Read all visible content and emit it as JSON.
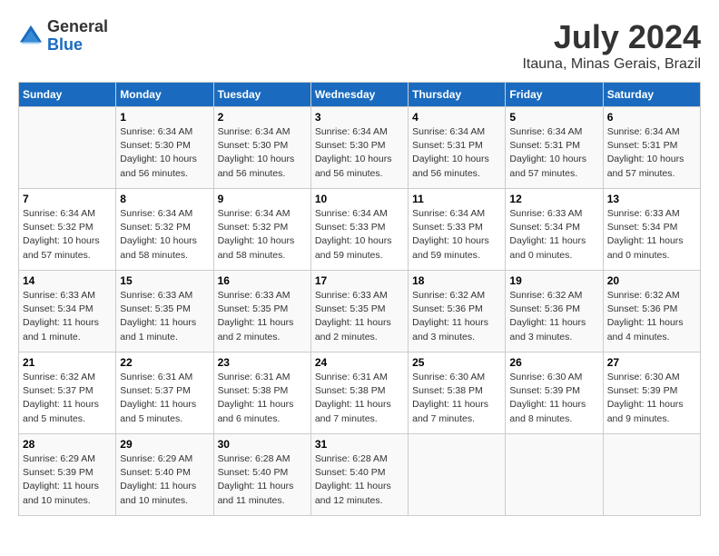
{
  "header": {
    "logo_general": "General",
    "logo_blue": "Blue",
    "month_title": "July 2024",
    "location": "Itauna, Minas Gerais, Brazil"
  },
  "days_of_week": [
    "Sunday",
    "Monday",
    "Tuesday",
    "Wednesday",
    "Thursday",
    "Friday",
    "Saturday"
  ],
  "weeks": [
    [
      {
        "day": "",
        "info": ""
      },
      {
        "day": "1",
        "info": "Sunrise: 6:34 AM\nSunset: 5:30 PM\nDaylight: 10 hours\nand 56 minutes."
      },
      {
        "day": "2",
        "info": "Sunrise: 6:34 AM\nSunset: 5:30 PM\nDaylight: 10 hours\nand 56 minutes."
      },
      {
        "day": "3",
        "info": "Sunrise: 6:34 AM\nSunset: 5:30 PM\nDaylight: 10 hours\nand 56 minutes."
      },
      {
        "day": "4",
        "info": "Sunrise: 6:34 AM\nSunset: 5:31 PM\nDaylight: 10 hours\nand 56 minutes."
      },
      {
        "day": "5",
        "info": "Sunrise: 6:34 AM\nSunset: 5:31 PM\nDaylight: 10 hours\nand 57 minutes."
      },
      {
        "day": "6",
        "info": "Sunrise: 6:34 AM\nSunset: 5:31 PM\nDaylight: 10 hours\nand 57 minutes."
      }
    ],
    [
      {
        "day": "7",
        "info": "Sunrise: 6:34 AM\nSunset: 5:32 PM\nDaylight: 10 hours\nand 57 minutes."
      },
      {
        "day": "8",
        "info": "Sunrise: 6:34 AM\nSunset: 5:32 PM\nDaylight: 10 hours\nand 58 minutes."
      },
      {
        "day": "9",
        "info": "Sunrise: 6:34 AM\nSunset: 5:32 PM\nDaylight: 10 hours\nand 58 minutes."
      },
      {
        "day": "10",
        "info": "Sunrise: 6:34 AM\nSunset: 5:33 PM\nDaylight: 10 hours\nand 59 minutes."
      },
      {
        "day": "11",
        "info": "Sunrise: 6:34 AM\nSunset: 5:33 PM\nDaylight: 10 hours\nand 59 minutes."
      },
      {
        "day": "12",
        "info": "Sunrise: 6:33 AM\nSunset: 5:34 PM\nDaylight: 11 hours\nand 0 minutes."
      },
      {
        "day": "13",
        "info": "Sunrise: 6:33 AM\nSunset: 5:34 PM\nDaylight: 11 hours\nand 0 minutes."
      }
    ],
    [
      {
        "day": "14",
        "info": "Sunrise: 6:33 AM\nSunset: 5:34 PM\nDaylight: 11 hours\nand 1 minute."
      },
      {
        "day": "15",
        "info": "Sunrise: 6:33 AM\nSunset: 5:35 PM\nDaylight: 11 hours\nand 1 minute."
      },
      {
        "day": "16",
        "info": "Sunrise: 6:33 AM\nSunset: 5:35 PM\nDaylight: 11 hours\nand 2 minutes."
      },
      {
        "day": "17",
        "info": "Sunrise: 6:33 AM\nSunset: 5:35 PM\nDaylight: 11 hours\nand 2 minutes."
      },
      {
        "day": "18",
        "info": "Sunrise: 6:32 AM\nSunset: 5:36 PM\nDaylight: 11 hours\nand 3 minutes."
      },
      {
        "day": "19",
        "info": "Sunrise: 6:32 AM\nSunset: 5:36 PM\nDaylight: 11 hours\nand 3 minutes."
      },
      {
        "day": "20",
        "info": "Sunrise: 6:32 AM\nSunset: 5:36 PM\nDaylight: 11 hours\nand 4 minutes."
      }
    ],
    [
      {
        "day": "21",
        "info": "Sunrise: 6:32 AM\nSunset: 5:37 PM\nDaylight: 11 hours\nand 5 minutes."
      },
      {
        "day": "22",
        "info": "Sunrise: 6:31 AM\nSunset: 5:37 PM\nDaylight: 11 hours\nand 5 minutes."
      },
      {
        "day": "23",
        "info": "Sunrise: 6:31 AM\nSunset: 5:38 PM\nDaylight: 11 hours\nand 6 minutes."
      },
      {
        "day": "24",
        "info": "Sunrise: 6:31 AM\nSunset: 5:38 PM\nDaylight: 11 hours\nand 7 minutes."
      },
      {
        "day": "25",
        "info": "Sunrise: 6:30 AM\nSunset: 5:38 PM\nDaylight: 11 hours\nand 7 minutes."
      },
      {
        "day": "26",
        "info": "Sunrise: 6:30 AM\nSunset: 5:39 PM\nDaylight: 11 hours\nand 8 minutes."
      },
      {
        "day": "27",
        "info": "Sunrise: 6:30 AM\nSunset: 5:39 PM\nDaylight: 11 hours\nand 9 minutes."
      }
    ],
    [
      {
        "day": "28",
        "info": "Sunrise: 6:29 AM\nSunset: 5:39 PM\nDaylight: 11 hours\nand 10 minutes."
      },
      {
        "day": "29",
        "info": "Sunrise: 6:29 AM\nSunset: 5:40 PM\nDaylight: 11 hours\nand 10 minutes."
      },
      {
        "day": "30",
        "info": "Sunrise: 6:28 AM\nSunset: 5:40 PM\nDaylight: 11 hours\nand 11 minutes."
      },
      {
        "day": "31",
        "info": "Sunrise: 6:28 AM\nSunset: 5:40 PM\nDaylight: 11 hours\nand 12 minutes."
      },
      {
        "day": "",
        "info": ""
      },
      {
        "day": "",
        "info": ""
      },
      {
        "day": "",
        "info": ""
      }
    ]
  ]
}
